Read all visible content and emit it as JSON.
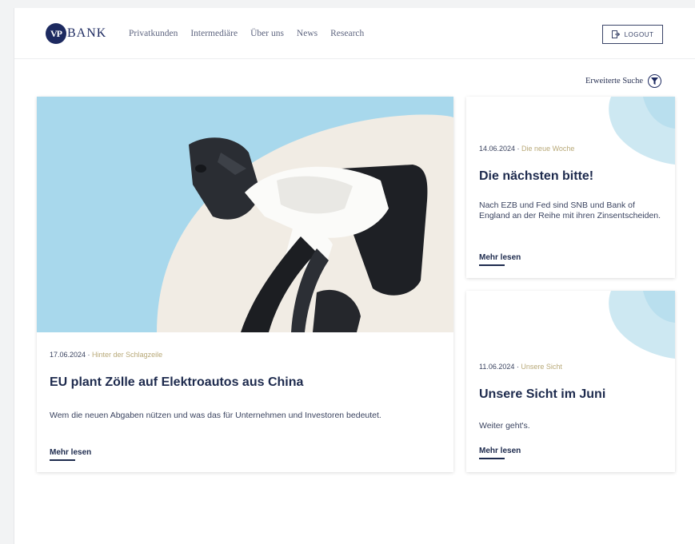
{
  "brand": {
    "logo_mark": "VP",
    "logo_word": "BANK"
  },
  "nav": [
    {
      "label": "Privatkunden"
    },
    {
      "label": "Intermediäre"
    },
    {
      "label": "Über uns"
    },
    {
      "label": "News"
    },
    {
      "label": "Research"
    }
  ],
  "logout": {
    "label": "LOGOUT",
    "icon": "logout-icon"
  },
  "advanced_search": {
    "label": "Erweiterte Suche",
    "icon": "filter-icon"
  },
  "articles": [
    {
      "date": "17.06.2024",
      "category": "Hinter der Schlagzeile",
      "title": "EU plant Zölle auf Elektroautos aus China",
      "description": "Wem die neuen Abgaben nützen und was das für Unternehmen und Investoren bedeutet.",
      "link": "Mehr lesen"
    },
    {
      "date": "14.06.2024",
      "category": "Die neue Woche",
      "title": "Die nächsten bitte!",
      "description": "Nach EZB und Fed sind SNB und Bank of England an der Reihe mit ihren Zinsentscheiden.",
      "link": "Mehr lesen"
    },
    {
      "date": "11.06.2024",
      "category": "Unsere Sicht",
      "title": "Unsere Sicht im Juni",
      "description": "Weiter geht's.",
      "link": "Mehr lesen"
    }
  ],
  "colors": {
    "navy": "#1d2a4d",
    "accent_gold": "#b8a978",
    "hero_sky": "#a8d8ec",
    "deco_blue": "#cde8f2"
  }
}
